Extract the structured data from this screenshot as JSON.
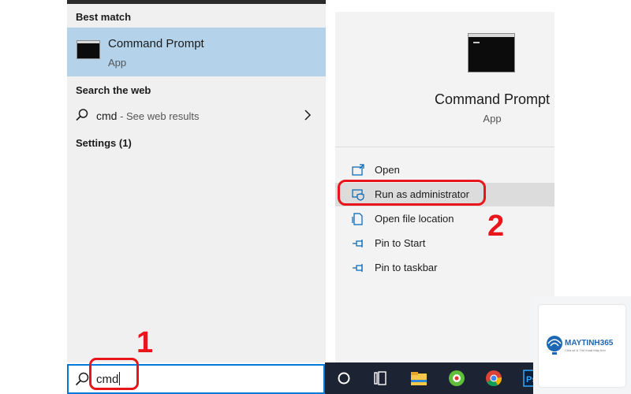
{
  "start_menu": {
    "best_match_label": "Best match",
    "best_match": {
      "title": "Command Prompt",
      "subtitle": "App"
    },
    "search_web_label": "Search the web",
    "web_result": {
      "query": "cmd",
      "suffix": " - See web results"
    },
    "settings_label": "Settings (1)"
  },
  "detail": {
    "title": "Command Prompt",
    "subtitle": "App",
    "actions": [
      {
        "label": "Open",
        "icon": "open-window-icon"
      },
      {
        "label": "Run as administrator",
        "icon": "shield-window-icon"
      },
      {
        "label": "Open file location",
        "icon": "file-location-icon"
      },
      {
        "label": "Pin to Start",
        "icon": "pin-icon"
      },
      {
        "label": "Pin to taskbar",
        "icon": "pin-icon"
      }
    ]
  },
  "search_box": {
    "value": "cmd",
    "icon": "search-icon"
  },
  "annotations": {
    "step_1": "1",
    "step_2": "2",
    "color": "#e8151b"
  },
  "taskbar": {
    "icons": [
      "cortana-circle-icon",
      "task-view-icon",
      "file-explorer-icon",
      "snip-tool-icon",
      "chrome-icon",
      "photoshop-icon"
    ]
  },
  "watermark": {
    "brand": "MAYTINH365",
    "tagline": "Chia sẻ & Thủ thuật Máy tính"
  },
  "colors": {
    "selection": "#b4d2ea",
    "hover": "#dcdcdc",
    "accent": "#0078d7",
    "taskbar": "#1c2433"
  }
}
